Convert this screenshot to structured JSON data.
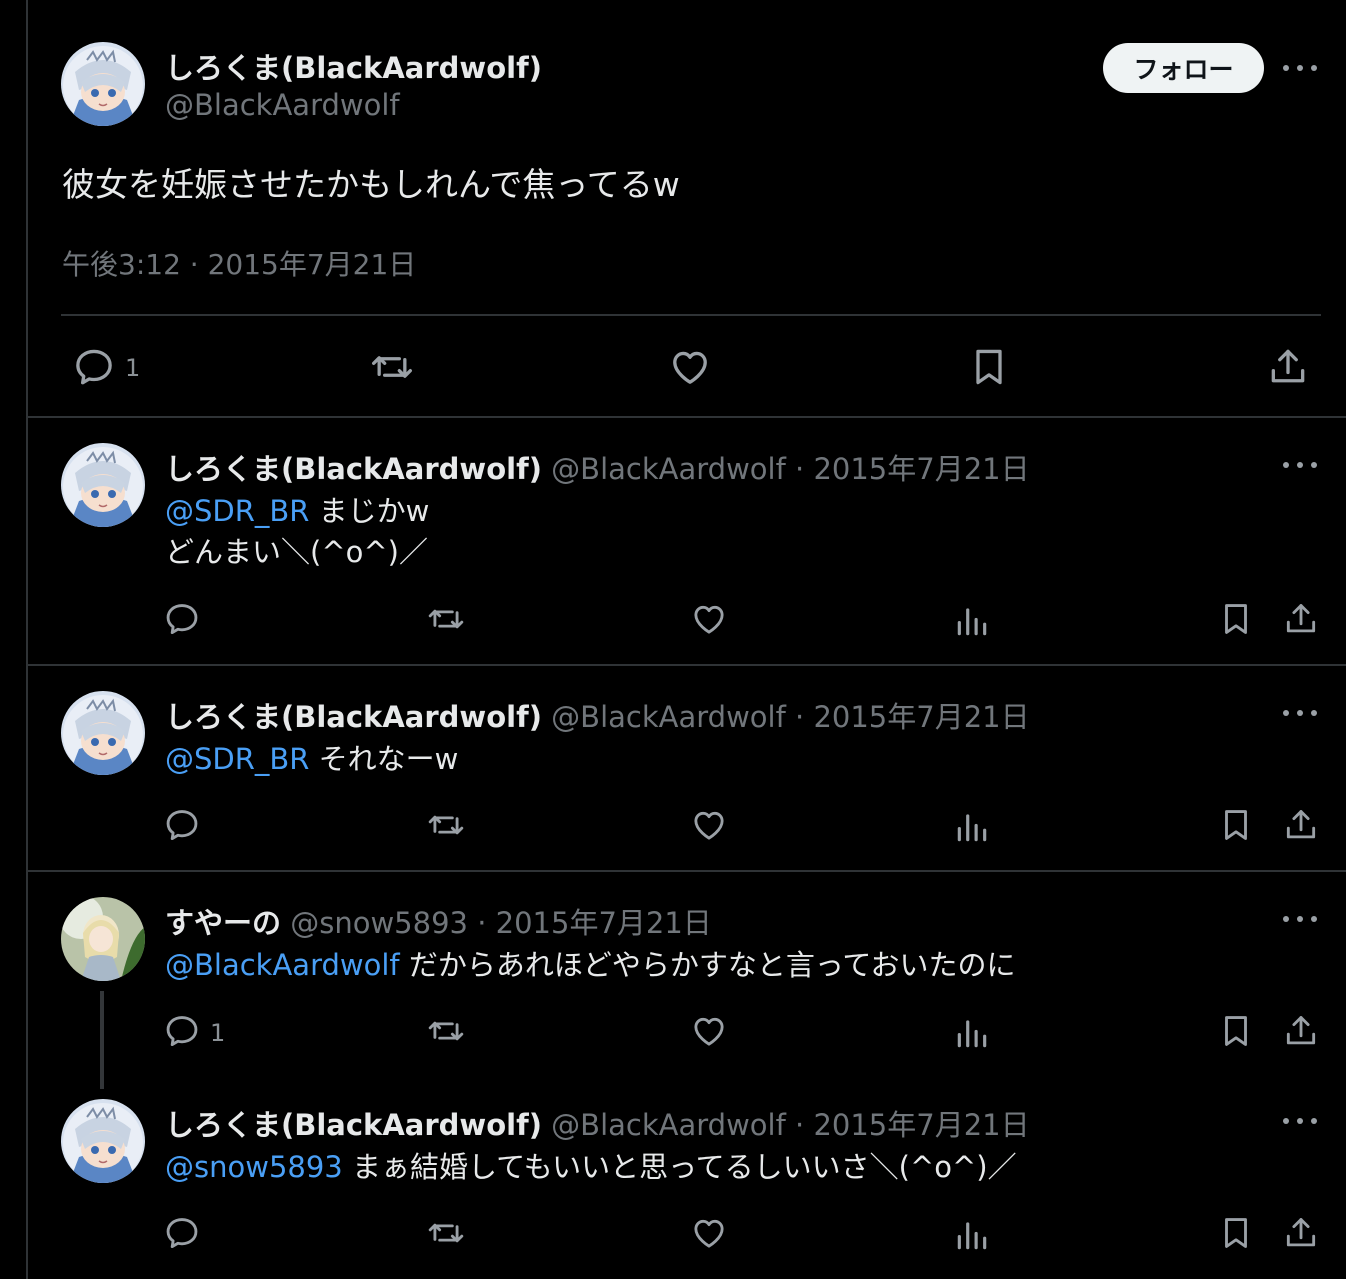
{
  "main_tweet": {
    "author_name": "しろくま(BlackAardwolf)",
    "handle": "@BlackAardwolf",
    "follow_label": "フォロー",
    "text": "彼女を妊娠させたかもしれんで焦ってるw",
    "timestamp": "午後3:12 · 2015年7月21日",
    "reply_count": "1"
  },
  "replies": [
    {
      "author_name": "しろくま(BlackAardwolf)",
      "handle": "@BlackAardwolf",
      "date": " · 2015年7月21日",
      "mention": "@SDR_BR",
      "text_line1": " まじかw",
      "text_line2": "どんまい＼(^o^)／"
    },
    {
      "author_name": "しろくま(BlackAardwolf)",
      "handle": "@BlackAardwolf",
      "date": " · 2015年7月21日",
      "mention": "@SDR_BR",
      "text_line1": " それなーw"
    },
    {
      "author_name": "すやーの",
      "handle": "@snow5893",
      "date": " · 2015年7月21日",
      "mention": "@BlackAardwolf",
      "text_line1": " だからあれほどやらかすなと言っておいたのに",
      "reply_count": "1"
    },
    {
      "author_name": "しろくま(BlackAardwolf)",
      "handle": "@BlackAardwolf",
      "date": " · 2015年7月21日",
      "mention": "@snow5893",
      "text_line1": " まぁ結婚してもいいと思ってるしいいさ＼(^o^)／"
    }
  ],
  "icons": [
    "reply-icon",
    "retweet-icon",
    "like-icon",
    "bookmark-icon",
    "share-icon",
    "views-icon",
    "more-icon"
  ],
  "colors": {
    "background": "#000000",
    "mention": "#4a9ff5",
    "muted": "#71767b",
    "divider": "#2f3336"
  }
}
